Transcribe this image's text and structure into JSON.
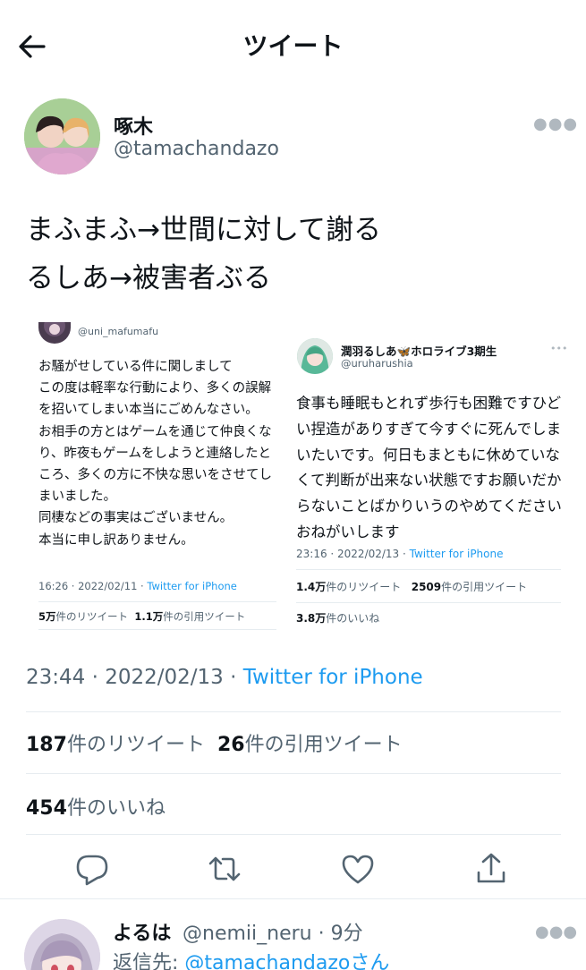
{
  "header": {
    "title": "ツイート",
    "back_icon": "arrow-left-icon"
  },
  "author": {
    "name": "啄木",
    "handle": "@tamachandazo"
  },
  "tweet": {
    "lines": [
      "まふまふ→世間に対して謝る",
      "るしあ→被害者ぶる"
    ]
  },
  "quote1": {
    "handle": "@uni_mafumafu",
    "text": "お騒がせしている件に関しまして\nこの度は軽率な行動により、多くの誤解を招いてしまい本当にごめんなさい。\nお相手の方とはゲームを通じて仲良くなり、昨夜もゲームをしようと連絡したところ、多くの方に不快な思いをさせてしまいました。\n同棲などの事実はございません。\n本当に申し訳ありません。",
    "time": "16:26 · 2022/02/11 · ",
    "client": "Twitter for iPhone",
    "retweets": "5万",
    "retweets_label": "件のリツイート",
    "quotes": "1.1万",
    "quotes_label": "件の引用ツイート"
  },
  "quote2": {
    "name": "潤羽るしあ🦋ホロライブ3期生",
    "handle": "@uruharushia",
    "text": "食事も睡眠もとれず歩行も困難ですひどい捏造がありすぎて今すぐに死んでしまいたいです。何日もまともに休めていなくて判断が出来ない状態ですお願いだからないことばかりいうのやめてくださいおねがいします",
    "time": "23:16 · 2022/02/13 · ",
    "client": "Twitter for iPhone",
    "retweets": "1.4万",
    "retweets_label": "件のリツイート",
    "quotes": "2509",
    "quotes_label": "件の引用ツイート",
    "likes": "3.8万",
    "likes_label": "件のいいね"
  },
  "meta": {
    "time": "23:44 · 2022/02/13 · ",
    "client": "Twitter for iPhone"
  },
  "stats": {
    "retweets": "187",
    "retweets_label": "件のリツイート",
    "quotes": "26",
    "quotes_label": "件の引用ツイート",
    "likes": "454",
    "likes_label": "件のいいね"
  },
  "actions": [
    "reply-icon",
    "retweet-icon",
    "like-icon",
    "share-icon"
  ],
  "reply": {
    "name": "よるは",
    "handle": "@nemii_neru · 9分",
    "to_label": "返信先: ",
    "to_handle": "@tamachandazo",
    "to_suffix": "さん"
  },
  "colors": {
    "link": "#1d9bf0",
    "text": "#0f1419",
    "muted": "#536471",
    "divider": "#e6ecf0"
  }
}
